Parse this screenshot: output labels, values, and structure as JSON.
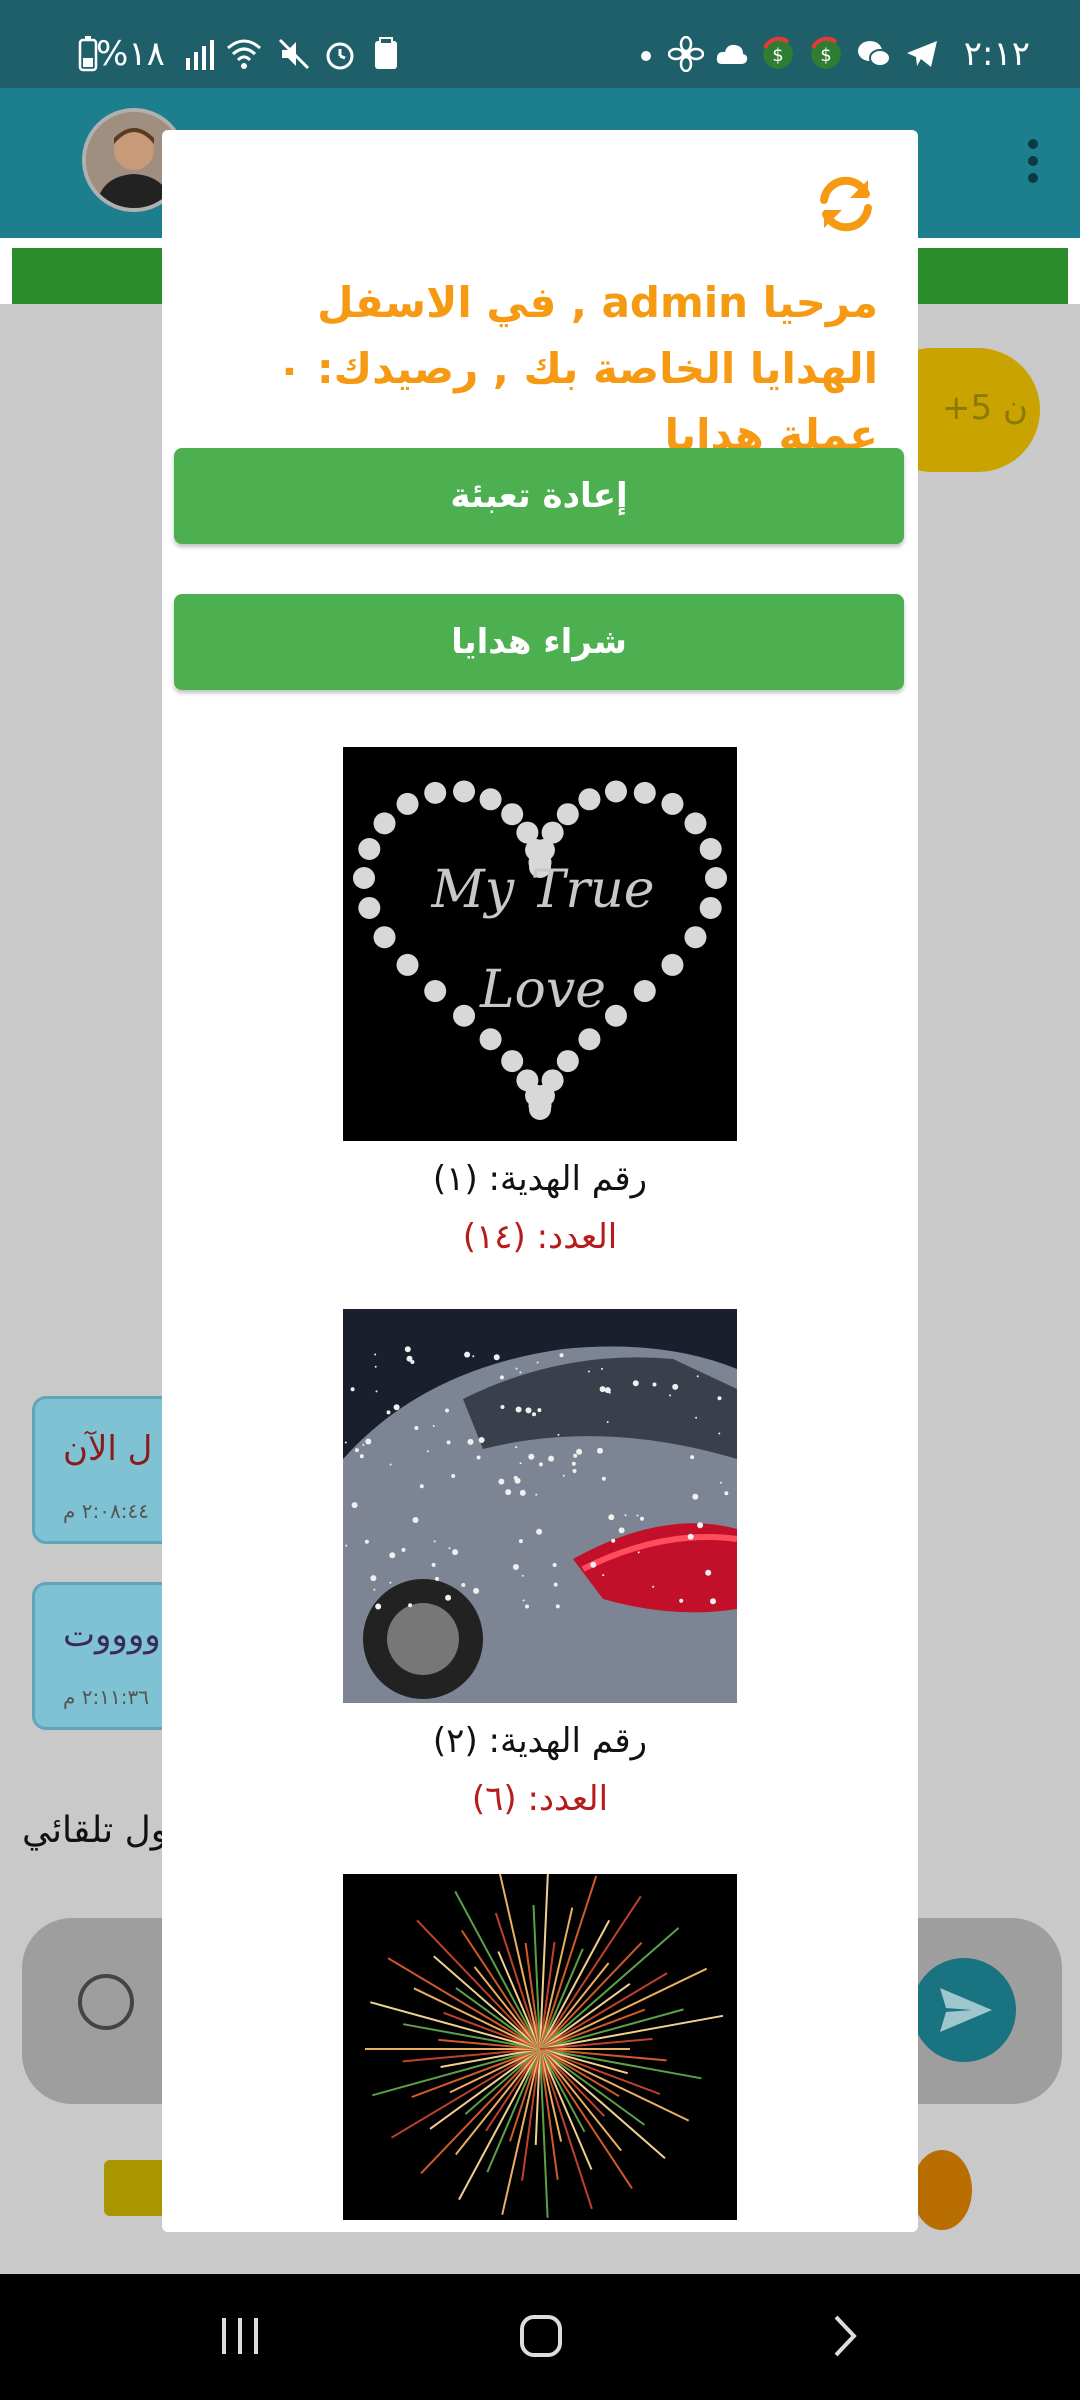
{
  "status_bar": {
    "time": "٢:١٢",
    "battery": "%١٨"
  },
  "dialog": {
    "welcome": "مرحيا admin , في الاسفل الهدايا الخاصة بك , رصيدك: ٠ عملة هدايا",
    "recharge_label": "إعادة تعبئة",
    "buy_gifts_label": "شراء هدايا",
    "gifts": [
      {
        "number": "رقم الهدية: (١)",
        "count": "العدد: (١٤)",
        "image_caption": "My True Love"
      },
      {
        "number": "رقم الهدية: (٢)",
        "count": "العدد: (٦)"
      },
      {
        "number": "",
        "count": ""
      }
    ]
  },
  "background_chat": {
    "bubbles": [
      {
        "text": "ل الآن",
        "time": "٢:٠٨:٤٤ م"
      },
      {
        "text": "ووووت",
        "time": "٢:١١:٣٦ م"
      }
    ],
    "auto_text": "ول تلقائي",
    "points_badge": "+5 ن"
  },
  "colors": {
    "accent_orange": "#f59a12",
    "button_green": "#4caf50",
    "count_red": "#b71c1c",
    "header_teal": "#1d7f8e"
  }
}
